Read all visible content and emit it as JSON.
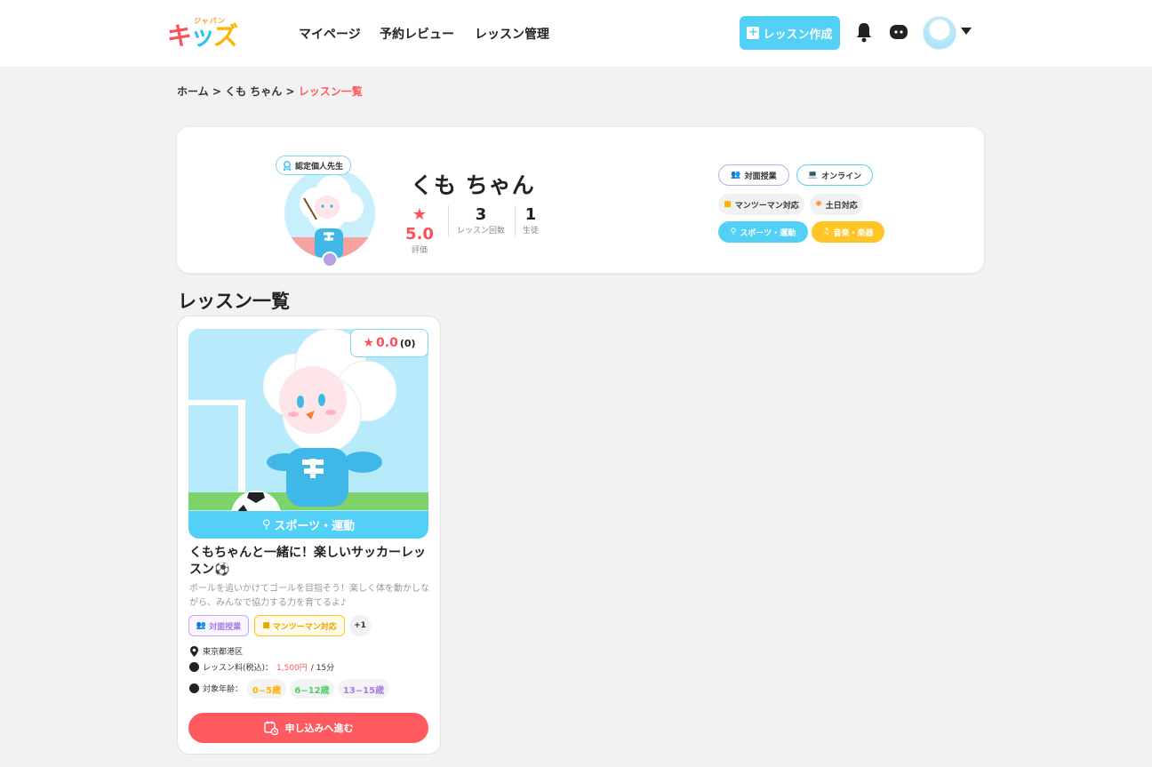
{
  "header": {
    "logo_sub": "ジャパン",
    "logo_c1": "キ",
    "logo_c2": "ッ",
    "logo_c3": "ズ",
    "nav": [
      "マイページ",
      "予約レビュー",
      "レッスン管理"
    ],
    "create_label": "レッスン作成",
    "icons": [
      "bell-icon",
      "chat-icon"
    ]
  },
  "breadcrumb": {
    "home": "ホーム",
    "sep": ">",
    "teacher": "くも ちゃん",
    "current": "レッスン一覧"
  },
  "profile": {
    "cert_label": "認定個人先生",
    "name": "くも ちゃん",
    "rating": "5.0",
    "rating_label": "評価",
    "lessons": "3",
    "lessons_label": "レッスン回数",
    "students": "1",
    "students_label": "生徒",
    "tags": {
      "in_person": "対面授業",
      "online": "オンライン",
      "one_on_one": "マンツーマン対応",
      "weekend": "土日対応",
      "sports": "スポーツ・運動",
      "music": "音楽・楽器"
    }
  },
  "section_title": "レッスン一覧",
  "lesson": {
    "rating": "0.0",
    "rating_count": "(0)",
    "category": "スポーツ・運動",
    "title": "くもちゃんと一緒に！楽しいサッカーレッスン⚽",
    "description": "ボールを追いかけてゴールを目指そう！楽しく体を動かしながら、みんなで協力する力を育てるよ♪",
    "tags": [
      "対面授業",
      "マンツーマン対応"
    ],
    "more": "+1",
    "location": "東京都港区",
    "fee_label": "レッスン料(税込)：",
    "fee_price": "1,500円",
    "fee_duration": "/ 15分",
    "age_label": "対象年齢：",
    "ages": [
      "0~5歳",
      "6~12歳",
      "13~15歳"
    ],
    "apply_label": "申し込みへ進む"
  },
  "colors": {
    "accent_blue": "#52d0f5",
    "accent_red": "#ff5a5f",
    "accent_yellow": "#ffc426",
    "accent_purple": "#c7a6ef"
  }
}
